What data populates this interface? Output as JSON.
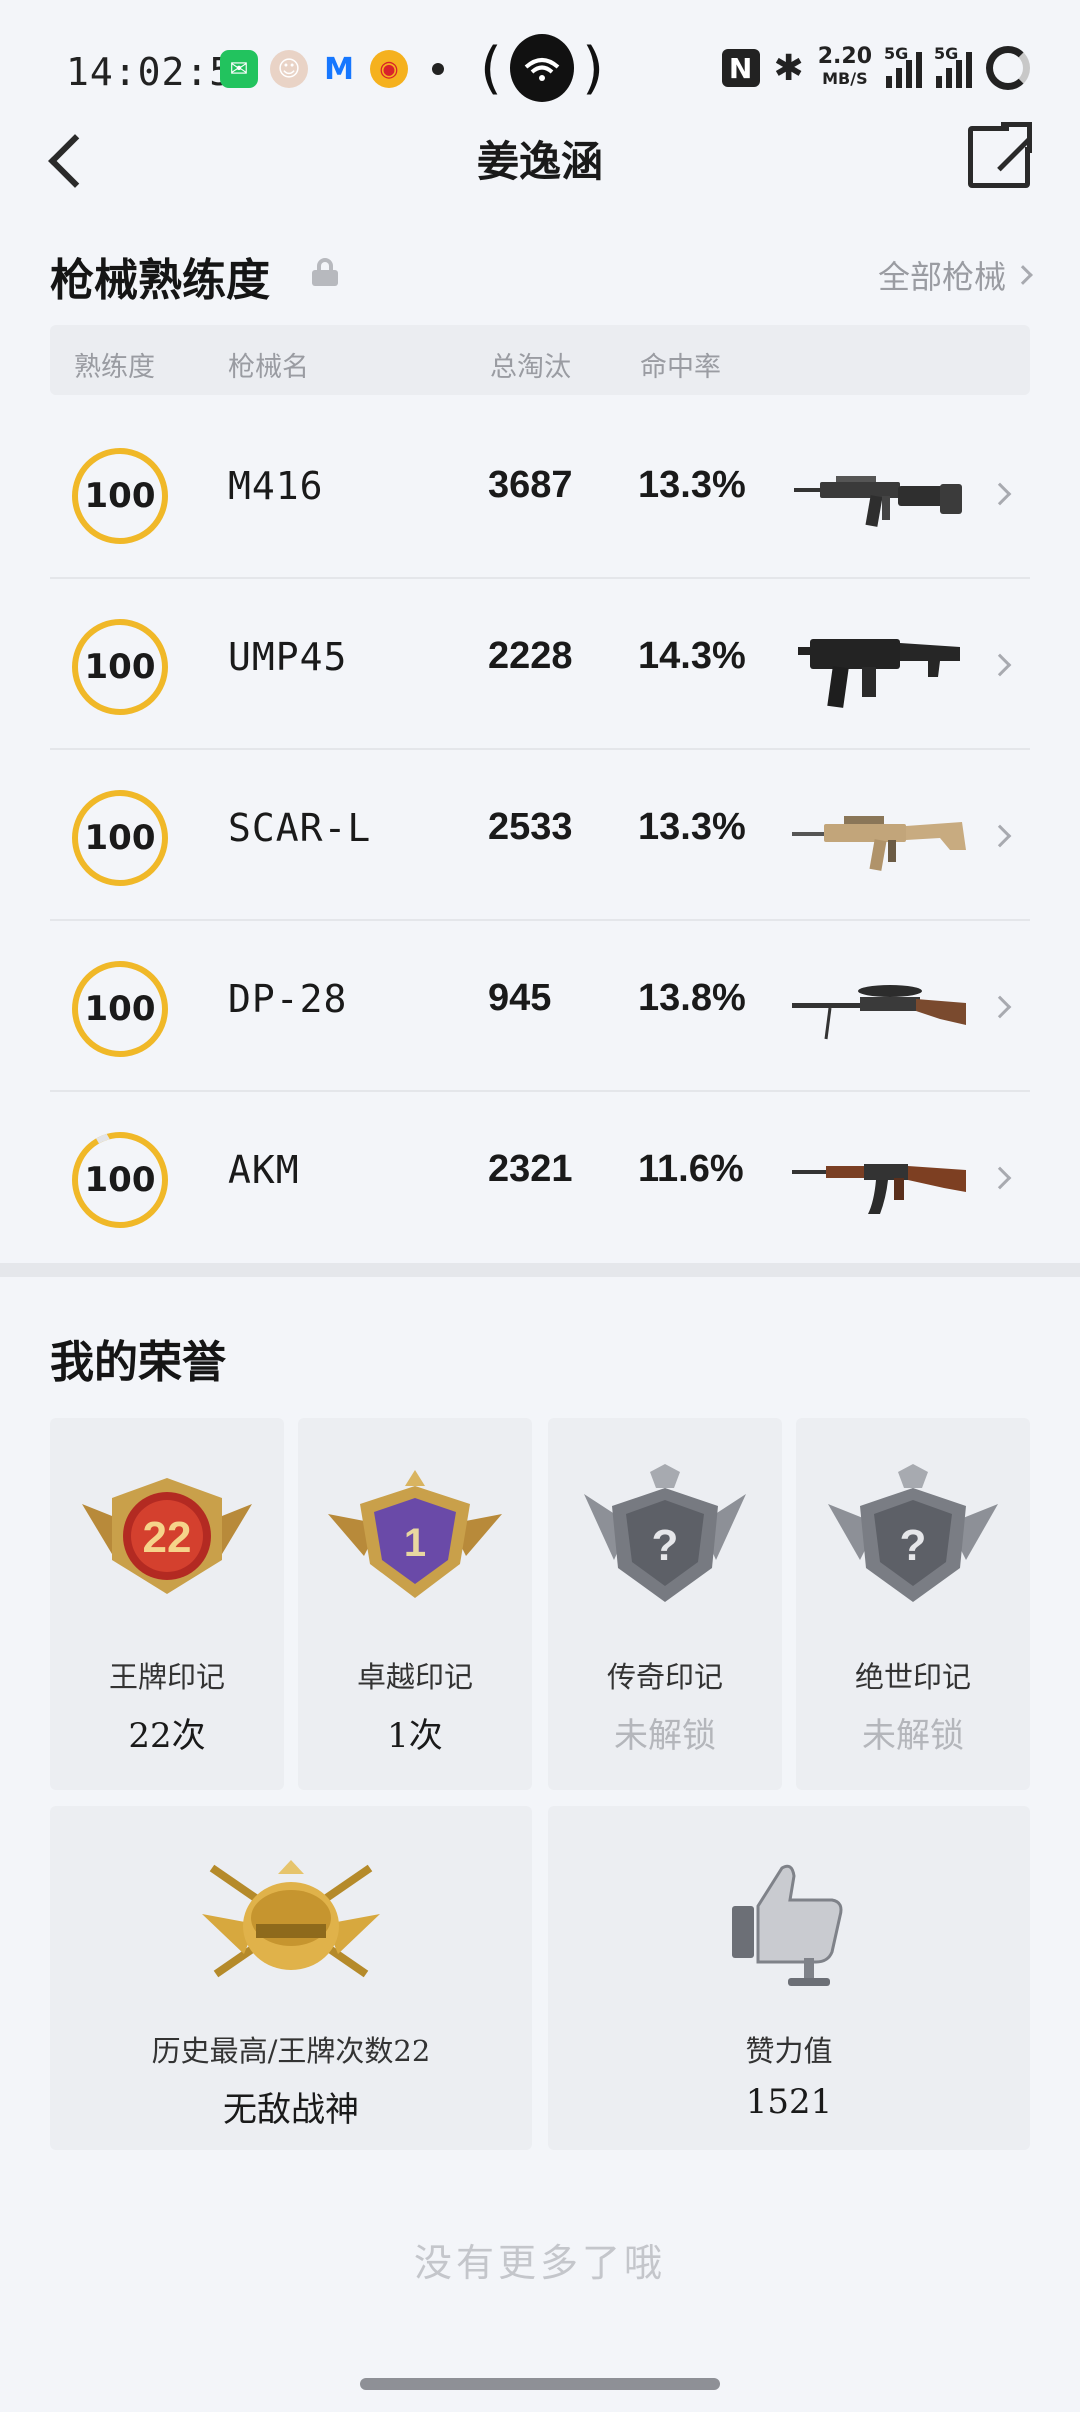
{
  "status_bar": {
    "time": "14:02:52",
    "speed_value": "2.20",
    "speed_unit": "MB/S",
    "network_1": "5G",
    "network_2": "5G"
  },
  "header": {
    "title": "姜逸涵"
  },
  "weapons_section": {
    "title": "枪械熟练度",
    "all_link": "全部枪械",
    "columns": [
      "熟练度",
      "枪械名",
      "总淘汰",
      "命中率"
    ],
    "rows": [
      {
        "proficiency": "100",
        "name": "M416",
        "kills": "3687",
        "hit_rate": "13.3%",
        "gun_icon": "m416-rifle"
      },
      {
        "proficiency": "100",
        "name": "UMP45",
        "kills": "2228",
        "hit_rate": "14.3%",
        "gun_icon": "ump45-smg"
      },
      {
        "proficiency": "100",
        "name": "SCAR-L",
        "kills": "2533",
        "hit_rate": "13.3%",
        "gun_icon": "scar-l-rifle"
      },
      {
        "proficiency": "100",
        "name": "DP-28",
        "kills": "945",
        "hit_rate": "13.8%",
        "gun_icon": "dp-28-lmg"
      },
      {
        "proficiency": "100",
        "name": "AKM",
        "kills": "2321",
        "hit_rate": "11.6%",
        "gun_icon": "akm-rifle"
      }
    ]
  },
  "honors_section": {
    "title": "我的荣誉",
    "marks": [
      {
        "label": "王牌印记",
        "value": "22次",
        "badge_number": "22",
        "locked": false
      },
      {
        "label": "卓越印记",
        "value": "1次",
        "badge_number": "1",
        "locked": false
      },
      {
        "label": "传奇印记",
        "value": "未解锁",
        "badge_number": "?",
        "locked": true
      },
      {
        "label": "绝世印记",
        "value": "未解锁",
        "badge_number": "?",
        "locked": true
      }
    ],
    "history": {
      "label": "历史最高/王牌次数22",
      "value": "无敌战神"
    },
    "likes": {
      "label": "赞力值",
      "value": "1521"
    }
  },
  "footer": {
    "no_more": "没有更多了哦"
  },
  "colors": {
    "accent_ring": "#f0b828",
    "background": "#f3f5f9"
  }
}
